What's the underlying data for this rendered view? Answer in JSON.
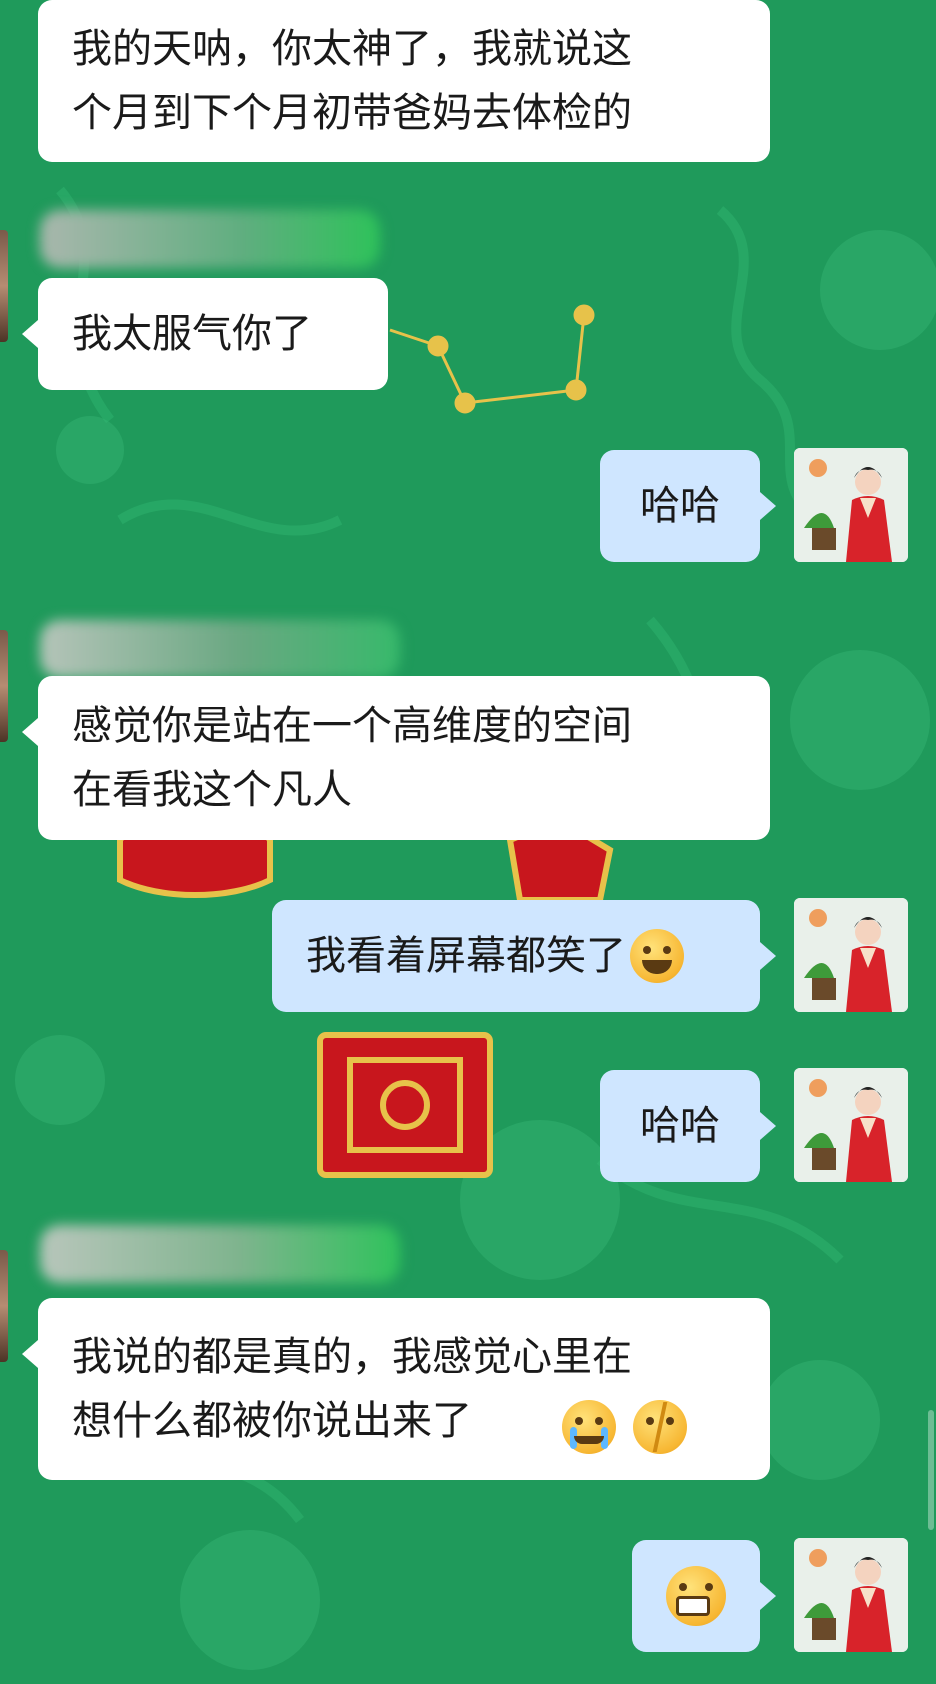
{
  "colors": {
    "background": "#1f9a5b",
    "incoming_bubble": "#ffffff",
    "outgoing_bubble": "#cfe6ff",
    "decor_red": "#c8161d",
    "decor_gold": "#e7c24a"
  },
  "messages": [
    {
      "direction": "incoming",
      "text": "我的天呐，你太神了，我就说这\n个月到下个月初带爸妈去体检的"
    },
    {
      "direction": "incoming",
      "text": "我太服气你了"
    },
    {
      "direction": "outgoing",
      "text": "哈哈"
    },
    {
      "direction": "incoming",
      "text": "感觉你是站在一个高维度的空间\n在看我这个凡人"
    },
    {
      "direction": "outgoing",
      "text": "我看着屏幕都笑了",
      "emoji": "tears-of-joy-emoji"
    },
    {
      "direction": "outgoing",
      "text": "哈哈"
    },
    {
      "direction": "incoming",
      "text": "我说的都是真的，我感觉心里在\n想什么都被你说出来了",
      "emojis": [
        "crying-emoji",
        "cracked-face-emoji"
      ]
    },
    {
      "direction": "outgoing",
      "text": "",
      "emoji": "grinning-emoji"
    }
  ]
}
